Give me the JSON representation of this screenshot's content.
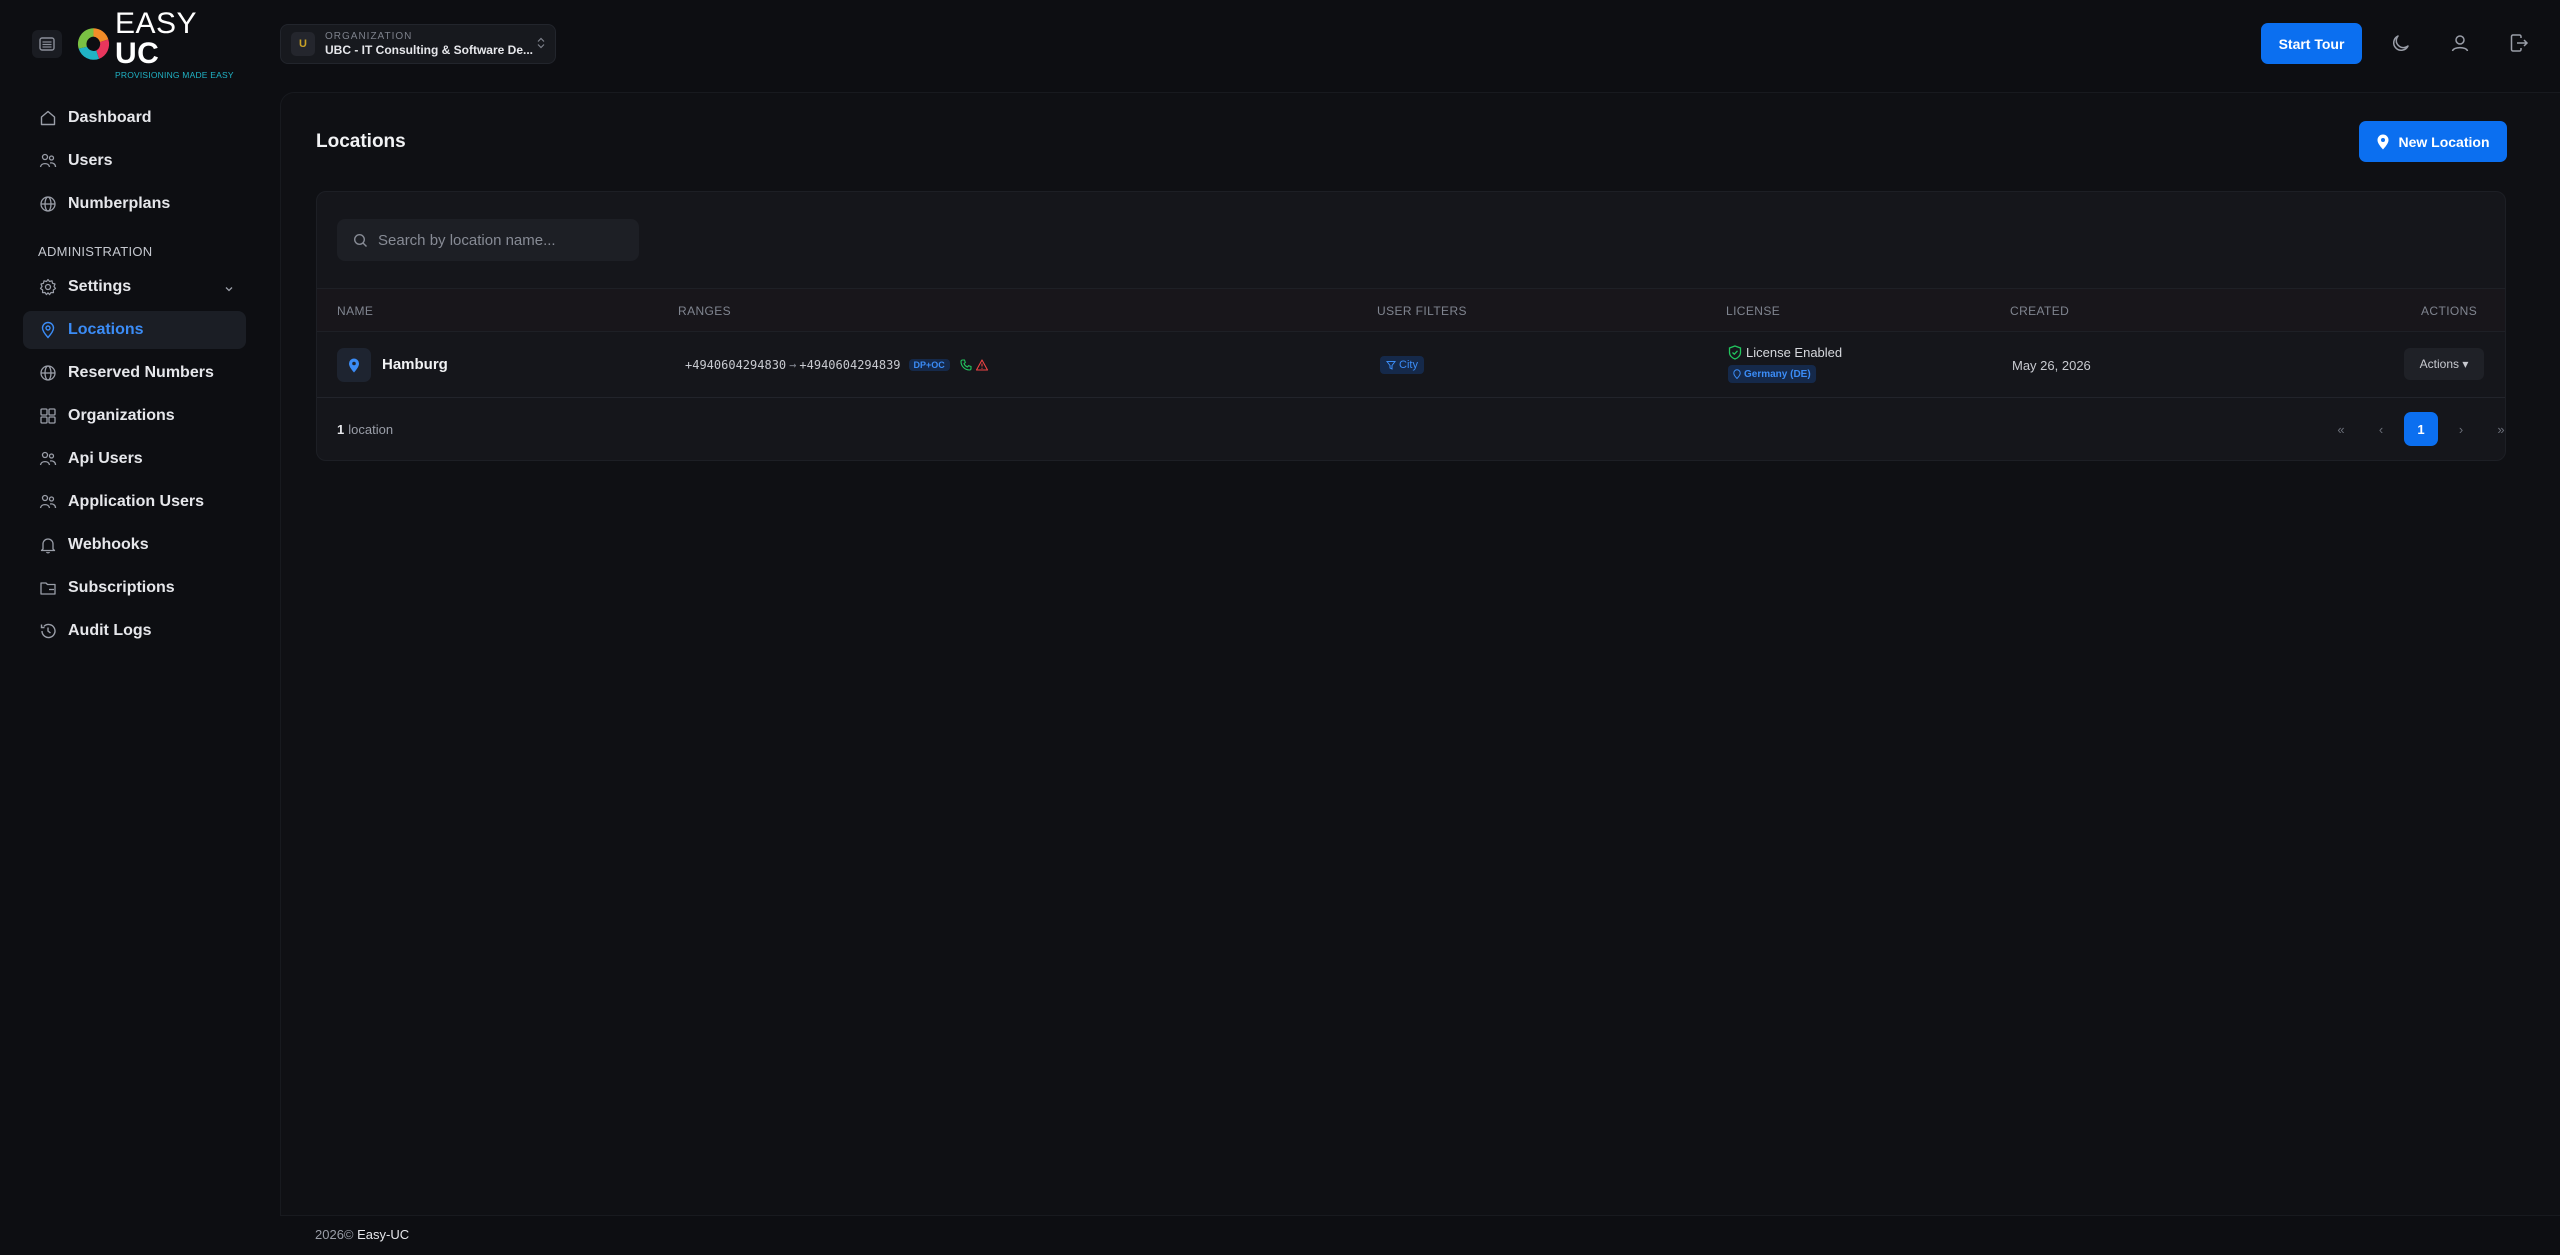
{
  "header": {
    "logo": {
      "brand_light": "EASY",
      "brand_bold": "UC",
      "tagline": "PROVISIONING MADE EASY"
    },
    "org": {
      "label": "ORGANIZATION",
      "avatar_letter": "U",
      "name": "UBC - IT Consulting & Software De..."
    },
    "start_tour_label": "Start Tour",
    "icons": [
      "moon-icon",
      "user-icon",
      "logout-icon"
    ]
  },
  "sidebar": {
    "items_top": [
      {
        "label": "Dashboard",
        "icon": "home-icon"
      },
      {
        "label": "Users",
        "icon": "users-icon"
      },
      {
        "label": "Numberplans",
        "icon": "globe-icon"
      }
    ],
    "section_label": "ADMINISTRATION",
    "items_admin": [
      {
        "label": "Settings",
        "icon": "gear-icon"
      },
      {
        "label": "Locations",
        "icon": "map-pin-icon",
        "active": true
      },
      {
        "label": "Reserved Numbers",
        "icon": "globe-icon"
      },
      {
        "label": "Organizations",
        "icon": "grid-icon"
      },
      {
        "label": "Api Users",
        "icon": "users-icon"
      },
      {
        "label": "Application Users",
        "icon": "users-icon"
      },
      {
        "label": "Webhooks",
        "icon": "bell-icon"
      },
      {
        "label": "Subscriptions",
        "icon": "folder-icon"
      },
      {
        "label": "Audit Logs",
        "icon": "history-icon"
      }
    ]
  },
  "main": {
    "title": "Locations",
    "new_location_label": "New Location",
    "search": {
      "placeholder": "Search by location name..."
    },
    "table": {
      "columns": {
        "name": "NAME",
        "ranges": "RANGES",
        "user_filters": "USER FILTERS",
        "license": "LICENSE",
        "created": "CREATED",
        "actions": "ACTIONS"
      },
      "rows": [
        {
          "name": "Hamburg",
          "range_start": "+4940604294830",
          "range_sep": "→",
          "range_end": "+4940604294839",
          "range_badge": "DP+OC",
          "user_filter": "City",
          "license_status": "License Enabled",
          "license_country": "Germany (DE)",
          "created": "May 26, 2026",
          "actions_label": "Actions ▾"
        }
      ]
    },
    "footer_count": {
      "number": "1",
      "unit": "location"
    },
    "pagination": {
      "first": "«",
      "prev": "‹",
      "current": "1",
      "next": "›",
      "last": "»"
    }
  },
  "footer": {
    "year": "2026©",
    "brand": "Easy-UC"
  },
  "colors": {
    "accent": "#0b6ff0",
    "link_active": "#3b8cf6",
    "success": "#22c55e",
    "danger": "#ef4444",
    "background": "#0d0e12"
  }
}
